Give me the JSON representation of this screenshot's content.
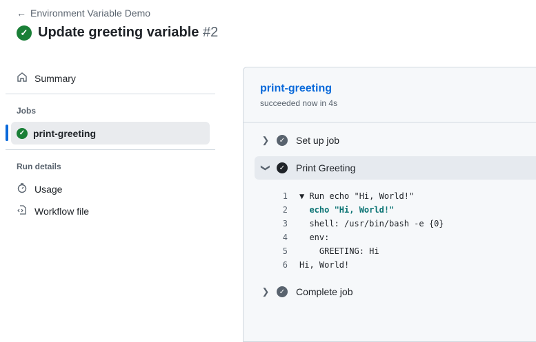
{
  "header": {
    "back_label": "Environment Variable Demo",
    "title": "Update greeting variable",
    "run_number": "#2",
    "status_color": "#1a7f37"
  },
  "sidebar": {
    "summary": "Summary",
    "jobs_heading": "Jobs",
    "jobs": [
      {
        "label": "print-greeting",
        "status": "success"
      }
    ],
    "run_details_heading": "Run details",
    "usage": "Usage",
    "workflow_file": "Workflow file"
  },
  "job": {
    "name": "print-greeting",
    "status_text": "succeeded now in 4s",
    "steps": [
      {
        "label": "Set up job",
        "expanded": false
      },
      {
        "label": "Print Greeting",
        "expanded": true
      },
      {
        "label": "Complete job",
        "expanded": false
      }
    ],
    "log": [
      {
        "n": "1",
        "text": "▼ Run echo \"Hi, World!\""
      },
      {
        "n": "2",
        "text": "  echo \"Hi, World!\""
      },
      {
        "n": "3",
        "text": "  shell: /usr/bin/bash -e {0}"
      },
      {
        "n": "4",
        "text": "  env:"
      },
      {
        "n": "5",
        "text": "    GREETING: Hi"
      },
      {
        "n": "6",
        "text": "Hi, World!"
      }
    ]
  }
}
